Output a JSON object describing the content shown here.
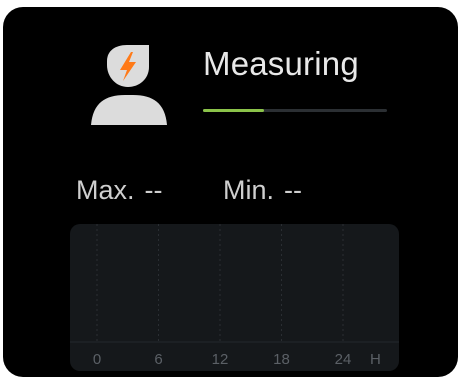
{
  "status": {
    "title": "Measuring",
    "progress_fraction": 0.33
  },
  "stats": {
    "max_label": "Max.",
    "max_value": "--",
    "min_label": "Min.",
    "min_value": "--"
  },
  "chart": {
    "x_ticks": [
      "0",
      "6",
      "12",
      "18",
      "24"
    ],
    "unit_label": "H"
  },
  "icons": {
    "avatar": "heart-rate-person-icon"
  },
  "colors": {
    "progress": "#8bc34a",
    "bolt": "#ff7a18"
  }
}
